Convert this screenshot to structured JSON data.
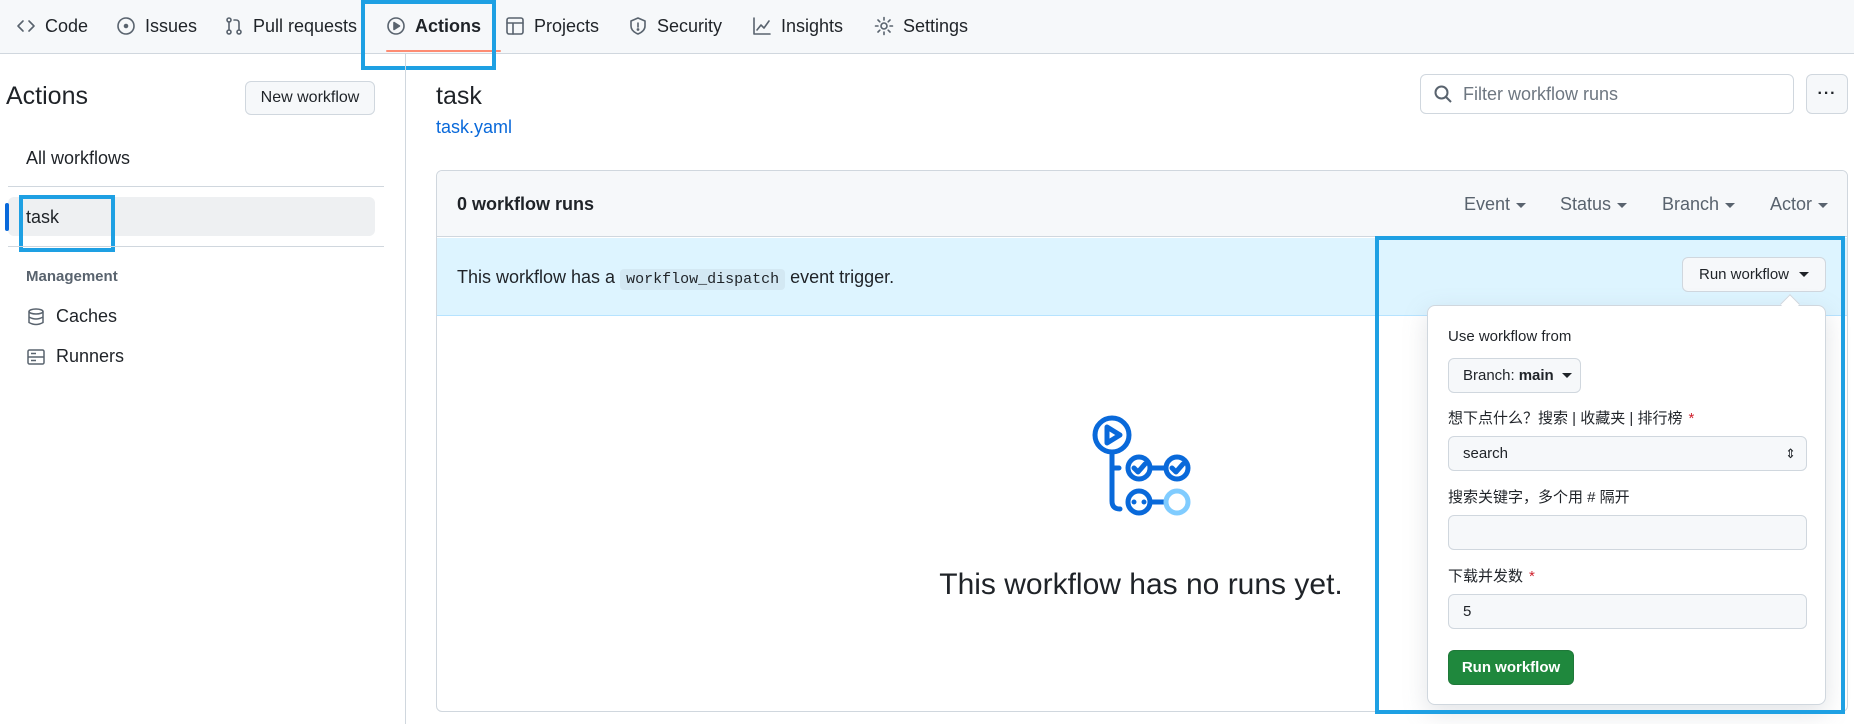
{
  "nav": {
    "tabs": [
      {
        "label": "Code",
        "icon": "code-icon"
      },
      {
        "label": "Issues",
        "icon": "issue-icon"
      },
      {
        "label": "Pull requests",
        "icon": "pull-request-icon"
      },
      {
        "label": "Actions",
        "icon": "play-icon"
      },
      {
        "label": "Projects",
        "icon": "table-icon"
      },
      {
        "label": "Security",
        "icon": "shield-icon"
      },
      {
        "label": "Insights",
        "icon": "graph-icon"
      },
      {
        "label": "Settings",
        "icon": "gear-icon"
      }
    ],
    "active_tab": "Actions"
  },
  "sidebar": {
    "title": "Actions",
    "new_workflow_label": "New workflow",
    "all_workflows_label": "All workflows",
    "workflows": [
      {
        "label": "task"
      }
    ],
    "management_heading": "Management",
    "management_items": [
      {
        "label": "Caches",
        "icon": "database-icon"
      },
      {
        "label": "Runners",
        "icon": "server-icon"
      }
    ]
  },
  "main": {
    "title": "task",
    "file_link": "task.yaml",
    "filter_placeholder": "Filter workflow runs",
    "more_label": "···",
    "runs_count": "0 workflow runs",
    "filters": [
      "Event",
      "Status",
      "Branch",
      "Actor"
    ],
    "dispatch_prefix": "This workflow has a",
    "dispatch_code": "workflow_dispatch",
    "dispatch_suffix": "event trigger.",
    "run_workflow_label": "Run workflow",
    "empty_text": "This workflow has no runs yet."
  },
  "run_panel": {
    "use_from_label": "Use workflow from",
    "branch_prefix": "Branch:",
    "branch_value": "main",
    "q1_label": "想下点什么？搜索 | 收藏夹 | 排行榜",
    "q1_value": "search",
    "q2_label": "搜索关键字，多个用 # 隔开",
    "q2_value": "",
    "q3_label": "下载并发数",
    "q3_value": "5",
    "required_mark": "*",
    "submit_label": "Run workflow"
  },
  "colors": {
    "accent": "#0969da",
    "highlight": "#1ea0e3",
    "success": "#1f883d",
    "active_underline": "#fd8c73"
  }
}
